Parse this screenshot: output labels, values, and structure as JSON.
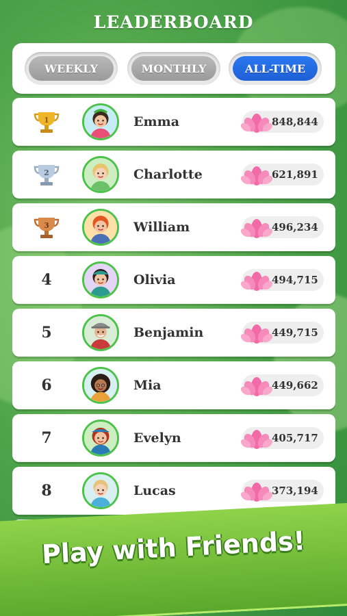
{
  "title": "LEADERBOARD",
  "tabs": [
    {
      "label": "WEEKLY",
      "active": false
    },
    {
      "label": "MONTHLY",
      "active": false
    },
    {
      "label": "ALL-TIME",
      "active": true
    }
  ],
  "entries": [
    {
      "rank": "1",
      "name": "Emma",
      "score": "848,844",
      "trophy": "gold"
    },
    {
      "rank": "2",
      "name": "Charlotte",
      "score": "621,891",
      "trophy": "silver"
    },
    {
      "rank": "3",
      "name": "William",
      "score": "496,234",
      "trophy": "bronze"
    },
    {
      "rank": "4",
      "name": "Olivia",
      "score": "494,715"
    },
    {
      "rank": "5",
      "name": "Benjamin",
      "score": "449,715"
    },
    {
      "rank": "6",
      "name": "Mia",
      "score": "449,662"
    },
    {
      "rank": "7",
      "name": "Evelyn",
      "score": "405,717"
    },
    {
      "rank": "8",
      "name": "Lucas",
      "score": "373,194"
    }
  ],
  "banner": "Play with Friends!",
  "colors": {
    "active_tab": "#2a78f0",
    "avatar_ring": "#4cc24a",
    "lotus": "#f26aa8"
  }
}
